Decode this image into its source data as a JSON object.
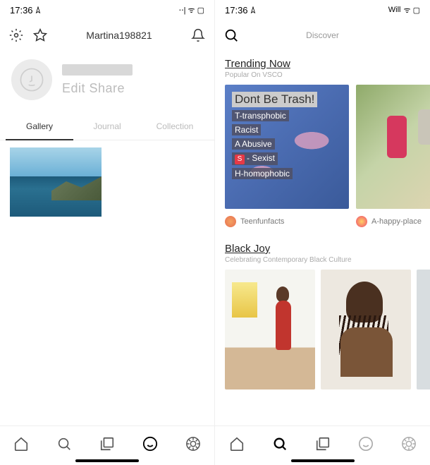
{
  "left": {
    "status": {
      "time": "17:36",
      "carrier_icons": "⋅⋅| ᯤ ▢"
    },
    "topbar": {
      "username": "Martina198821"
    },
    "profile": {
      "edit_share": "Edit Share"
    },
    "tabs": {
      "gallery": "Gallery",
      "journal": "Journal",
      "collection": "Collection"
    }
  },
  "right": {
    "status": {
      "time": "17:36",
      "carrier": "Will",
      "battery_icons": "ᯤ ▢"
    },
    "topbar": {
      "title": "Discover"
    },
    "trending": {
      "title": "Trending Now",
      "subtitle": "Popular On VSCO",
      "card1": {
        "title": "Dont Be Trash!",
        "lines": [
          "T-transphobic",
          "Racist",
          "A Abusive",
          "- Sexist",
          "H-homophobic"
        ],
        "caption": "Teenfunfacts"
      },
      "card2": {
        "caption": "A-happy-place"
      }
    },
    "blackjoy": {
      "title": "Black Joy",
      "subtitle": "Celebrating Contemporary Black Culture"
    }
  }
}
